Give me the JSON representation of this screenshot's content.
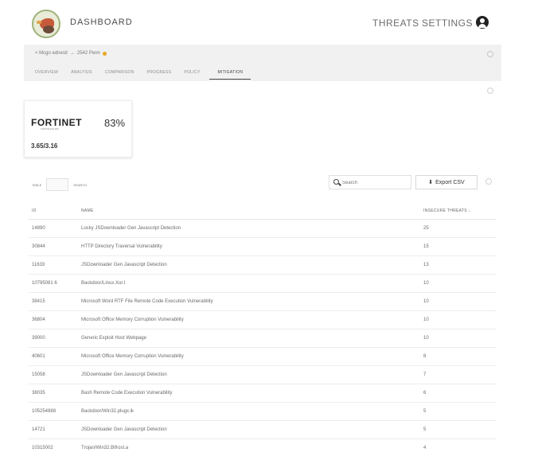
{
  "header": {
    "title": "DASHBOARD",
    "nav": {
      "threats": "THREATS",
      "settings": "SETTINGS"
    }
  },
  "breadcrumb": {
    "back": "< Mcgo ednesit",
    "arrow": "→",
    "current": "2542 Penn"
  },
  "tabs": [
    {
      "label": "OVERVIEW"
    },
    {
      "label": "ANALYSIS"
    },
    {
      "label": "COMPARISON"
    },
    {
      "label": "PROGRESS"
    },
    {
      "label": "POLICY"
    },
    {
      "label": "MITIGATION",
      "active": true
    }
  ],
  "vendor_card": {
    "logo_text": "FORTINET",
    "logo_sub": "FORTIGATE 900",
    "score": "83%",
    "ratio": "3.65/3.16"
  },
  "table_controls": {
    "left_label": "TABLE",
    "right_label": "SEARCH",
    "search_placeholder": "Search",
    "export_label": "Export CSV"
  },
  "table": {
    "columns": {
      "id": "ID",
      "name": "NAME",
      "count": "INSECURE THREATS ↓"
    },
    "rows": [
      {
        "id": "14890",
        "name": "Locky JSDownloader Gen Javascript Detection",
        "count": "25"
      },
      {
        "id": "30844",
        "name": "HTTP Directory Traversal Vulnerability",
        "count": "15"
      },
      {
        "id": "11633",
        "name": "JSDownloader Gen Javascript Detection",
        "count": "13"
      },
      {
        "id": "10795081 6",
        "name": "Backdoor/Linux.Xor.I",
        "count": "10"
      },
      {
        "id": "38415",
        "name": "Microsoft Word RTF File Remote Code Execution Vulnerability",
        "count": "10"
      },
      {
        "id": "36804",
        "name": "Microsoft Office Memory Corruption Vulnerability",
        "count": "10"
      },
      {
        "id": "39000",
        "name": "Generic Exploit Host Webpage",
        "count": "10"
      },
      {
        "id": "40601",
        "name": "Microsoft Office Memory Corruption Vulnerability",
        "count": "8"
      },
      {
        "id": "15058",
        "name": "JSDownloader Gen Javascript Detection",
        "count": "7"
      },
      {
        "id": "38035",
        "name": "Bash Remote Code Execution Vulnerability",
        "count": "6"
      },
      {
        "id": "105254888",
        "name": "Backdoor/Win32.plugx.ik",
        "count": "5"
      },
      {
        "id": "14721",
        "name": "JSDownloader Gen Javascript Detection",
        "count": "5"
      },
      {
        "id": "10315002",
        "name": "Trojan/Win32.Bifrost.a",
        "count": "4"
      }
    ]
  }
}
